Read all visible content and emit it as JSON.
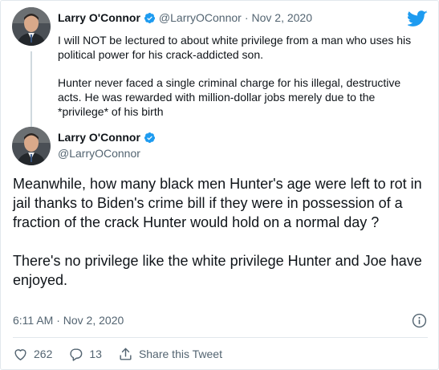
{
  "parent_tweet": {
    "author_name": "Larry O'Connor",
    "handle": "@LarryOConnor",
    "separator": "·",
    "date": "Nov 2, 2020",
    "paragraphs": [
      "I will NOT be lectured to about white privilege from a man who uses his political power for his crack-addicted son.",
      "Hunter never faced a single criminal charge for his illegal, destructive acts. He was rewarded with million-dollar jobs merely due to the *privilege* of his birth"
    ]
  },
  "main_tweet": {
    "author_name": "Larry O'Connor",
    "handle": "@LarryOConnor",
    "paragraphs": [
      "Meanwhile, how many black men Hunter's age were left to rot in jail thanks to Biden's crime bill if they were in possession of a fraction of the crack Hunter would hold on a normal day ?",
      "There's no privilege like the white privilege Hunter and Joe have enjoyed."
    ],
    "timestamp": "6:11 AM · Nov 2, 2020"
  },
  "actions": {
    "like_count": "262",
    "reply_count": "13",
    "share_label": "Share this Tweet"
  },
  "icons": {
    "logo": "twitter-bird-icon",
    "verified": "verified-badge-icon",
    "info": "info-icon",
    "like": "heart-icon",
    "reply": "reply-icon",
    "share": "share-icon"
  },
  "colors": {
    "brand_blue": "#1d9bf0",
    "text_primary": "#0f1419",
    "text_secondary": "#536471",
    "divider": "#e1e8ed",
    "thread_line": "#cfd9de"
  }
}
